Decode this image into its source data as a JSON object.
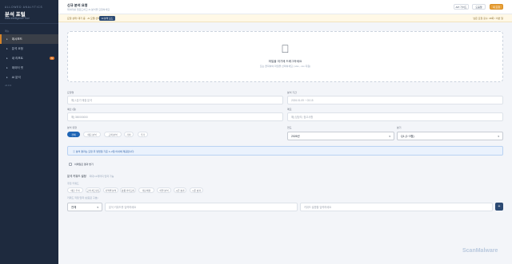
{
  "sidebar": {
    "brand_sub": "ALLOWED ANALYTICS",
    "brand_title": "분석 포털",
    "version": "Data Intelligence Tool",
    "section": "메뉴",
    "items": [
      {
        "label": "대시보드",
        "active": true,
        "badge": ""
      },
      {
        "label": "분석 요청",
        "active": false,
        "badge": ""
      },
      {
        "label": "내 리포트",
        "active": false,
        "badge": "N"
      },
      {
        "label": "데이터 셋",
        "active": false,
        "badge": ""
      },
      {
        "label": "AI 분석",
        "active": false,
        "badge": ""
      }
    ],
    "footer": "v2.0.3"
  },
  "header": {
    "title": "신규 분석 요청",
    "subtitle": "데이터를 업로드하고 AI 분석을 요청하세요",
    "api_label": "API 가이드",
    "guide_label": "도움말",
    "new_label": "새 요청"
  },
  "strip": {
    "text": "요청 상태: 대기 중 · AI 모델 선택 가능",
    "badge": "AI 분석 모드",
    "right": "남은 요청 횟수: 48회 / 이번 달"
  },
  "upload": {
    "icon": "upload-cloud-icon",
    "main": "파일을 여기에 드래그하세요",
    "hint": "또는 클릭하여 파일을 선택하세요 (.xlsx, .csv 지원)"
  },
  "form": {
    "name_label": "요청명",
    "name_placeholder": "예) 1분기 매출 분석",
    "period_label": "분석 기간",
    "period_value": "2026.01.09 ~ 03.15",
    "budget_label": "예산 (원)",
    "budget_placeholder": "예) 350000000",
    "memo_label": "메모",
    "memo_placeholder": "예) 담당자, 참고사항",
    "type_label": "분석 유형",
    "types": [
      "전체",
      "매출 분석",
      "고객 분석",
      "기타",
      "추가"
    ],
    "year_label": "연도",
    "year_value": "2026년",
    "quarter_label": "분기",
    "quarter_value": "Q1 (1~3월)"
  },
  "info": {
    "text": "ⓘ 분석 결과는 요청 후 영업일 기준 1~2일 이내에 제공됩니다."
  },
  "checkbox": {
    "label": "이메일로 결과 받기"
  },
  "keywords": {
    "title": "분석 키워드 설정",
    "note": "최대 10개까지 입력 가능",
    "recommended_label": "추천 키워드",
    "chips": [
      "매출 추이",
      "고객 세그먼트",
      "지역별 분석",
      "상품 카테고리",
      "재구매율",
      "이탈 분석",
      "시즌 효과"
    ],
    "custom_label": "키워드 직접 입력 (쉼표로 구분)",
    "select_value": "전체",
    "keyword_placeholder": "분석 키워드를 입력하세요",
    "desc_placeholder": "키워드 설명을 입력하세요",
    "add_label": "+"
  },
  "watermark": "ScanMalware"
}
